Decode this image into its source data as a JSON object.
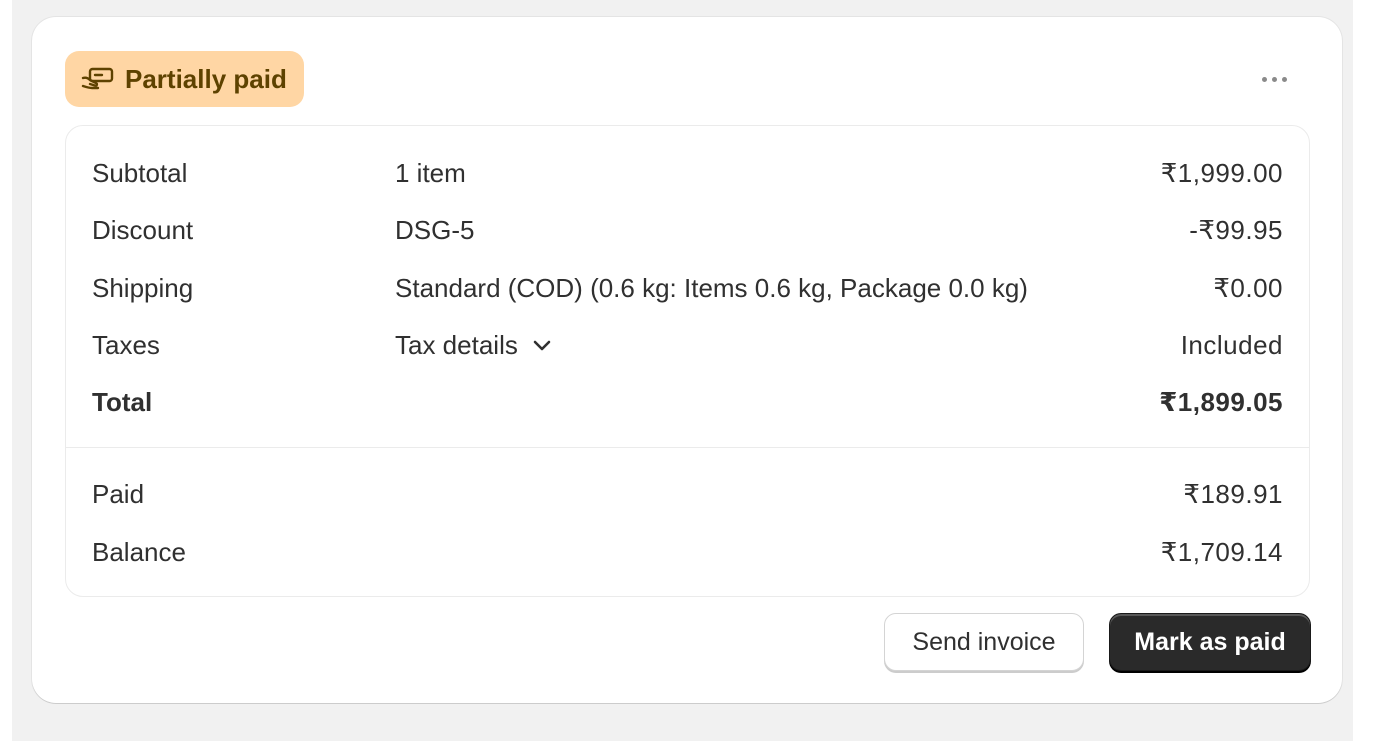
{
  "status_badge": {
    "label": "Partially paid",
    "icon": "cash-hand-icon",
    "background": "#ffd6a4",
    "text_color": "#5e4200"
  },
  "more_actions": {
    "icon": "more-horizontal-icon"
  },
  "summary": {
    "rows": [
      {
        "label": "Subtotal",
        "description": "1 item",
        "amount": "₹1,999.00"
      },
      {
        "label": "Discount",
        "description": "DSG-5",
        "amount": "-₹99.95"
      },
      {
        "label": "Shipping",
        "description": "Standard (COD) (0.6 kg: Items 0.6 kg, Package 0.0 kg)",
        "amount": "₹0.00"
      },
      {
        "label": "Taxes",
        "description": "Tax details",
        "amount": "Included"
      },
      {
        "label": "Total",
        "description": "",
        "amount": "₹1,899.05"
      }
    ],
    "payments": [
      {
        "label": "Paid",
        "amount": "₹189.91"
      },
      {
        "label": "Balance",
        "amount": "₹1,709.14"
      }
    ]
  },
  "actions": {
    "send_invoice": "Send invoice",
    "mark_as_paid": "Mark as paid"
  },
  "colors": {
    "page_background": "#f1f1f1",
    "card_background": "#ffffff",
    "primary_button": "#2a2a2a",
    "text": "#303030"
  }
}
